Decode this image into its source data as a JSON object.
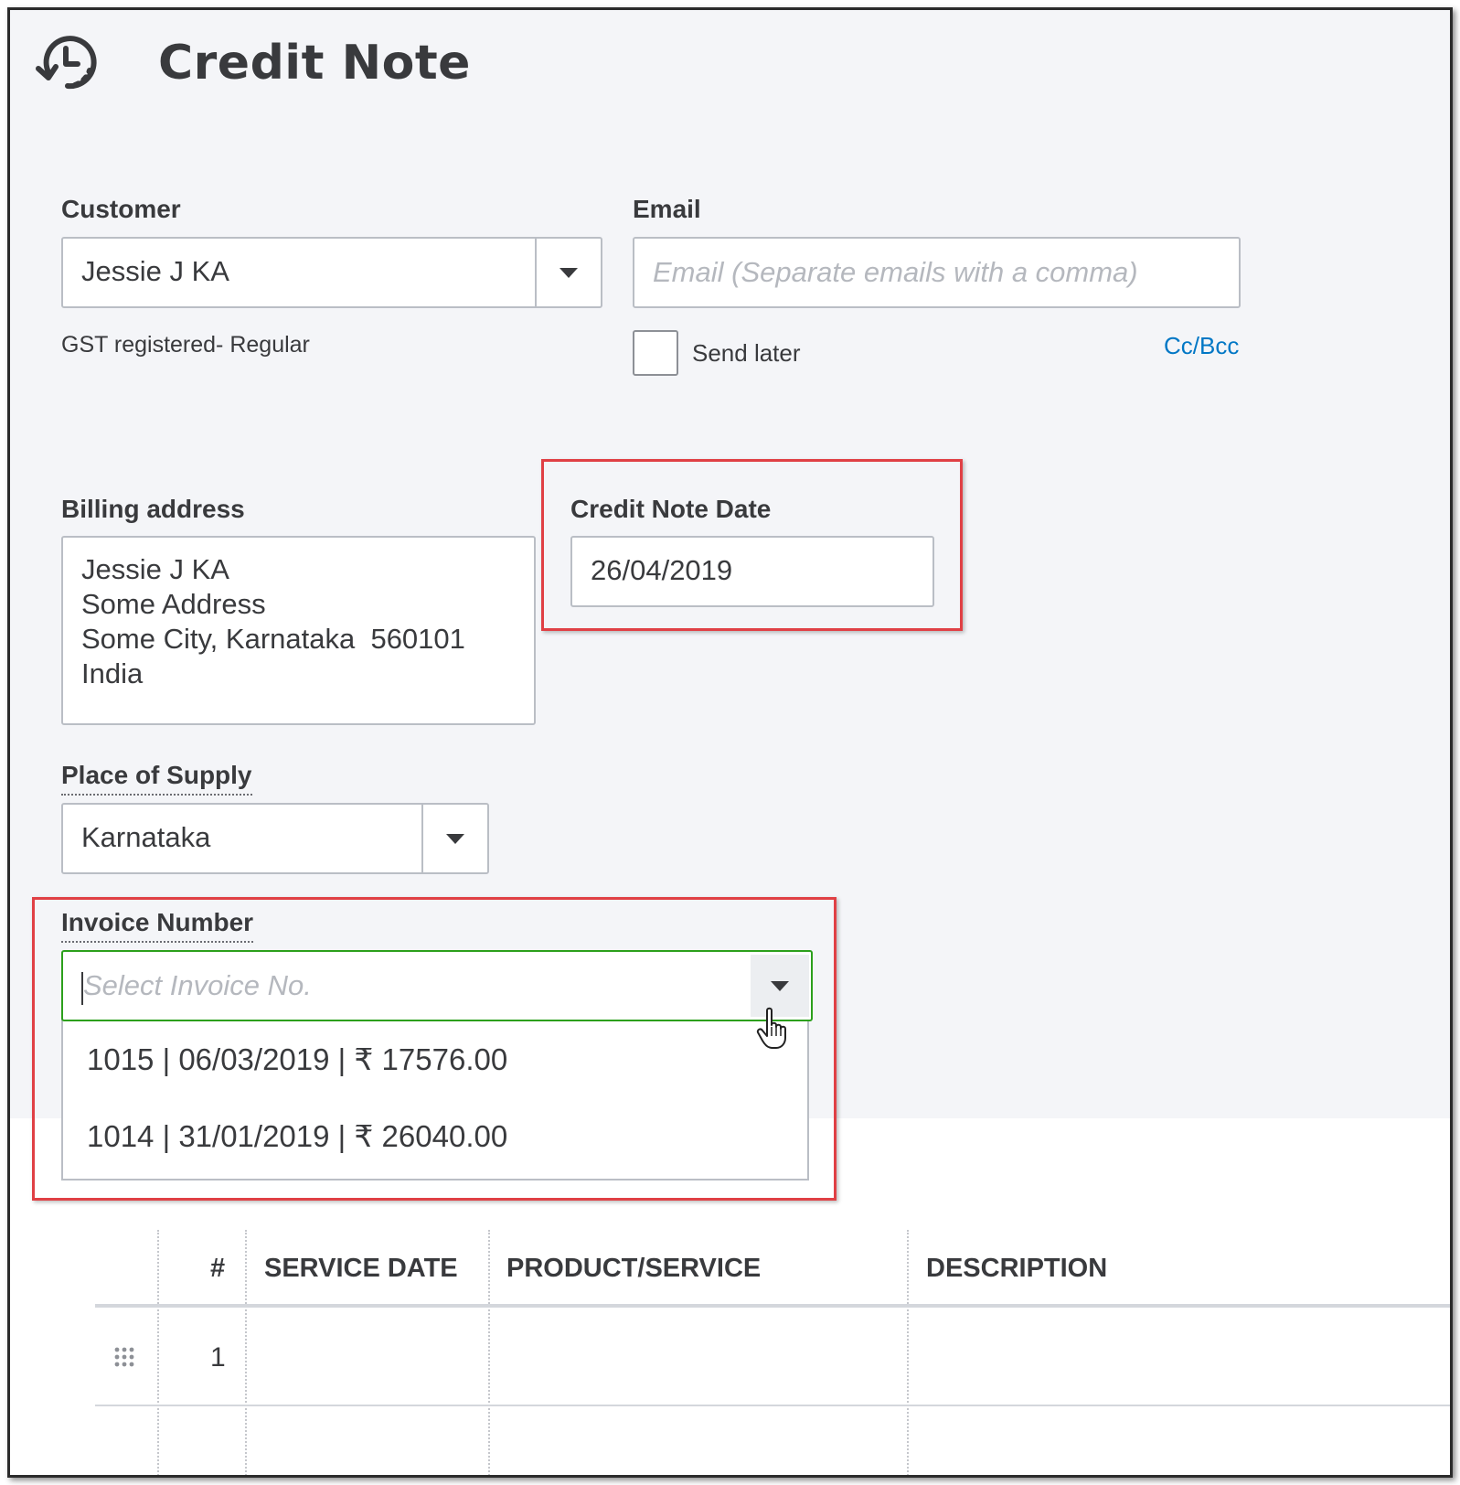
{
  "header": {
    "title": "Credit Note",
    "icon": "recurring-clock-icon"
  },
  "customer": {
    "label": "Customer",
    "value": "Jessie J KA",
    "tax_status": "GST registered- Regular"
  },
  "email": {
    "label": "Email",
    "placeholder": "Email (Separate emails with a comma)",
    "send_later_label": "Send later",
    "send_later_checked": false,
    "cc_bcc_label": "Cc/Bcc"
  },
  "billing": {
    "label": "Billing address",
    "lines": [
      "Jessie J KA",
      "Some Address",
      "Some City, Karnataka  560101",
      "India"
    ]
  },
  "credit_note_date": {
    "label": "Credit Note Date",
    "value": "26/04/2019"
  },
  "place_of_supply": {
    "label": "Place of Supply",
    "value": "Karnataka"
  },
  "invoice_number": {
    "label": "Invoice Number",
    "placeholder": "Select Invoice No.",
    "options": [
      "1015 | 06/03/2019 | ₹ 17576.00",
      "1014 | 31/01/2019 | ₹ 26040.00"
    ]
  },
  "table": {
    "headers": [
      "#",
      "SERVICE DATE",
      "PRODUCT/SERVICE",
      "DESCRIPTION"
    ],
    "rows": [
      {
        "num": "1"
      }
    ]
  },
  "colors": {
    "accent_link": "#0077c5",
    "highlight_border": "#e04045",
    "focus_border": "#2ca01c"
  }
}
